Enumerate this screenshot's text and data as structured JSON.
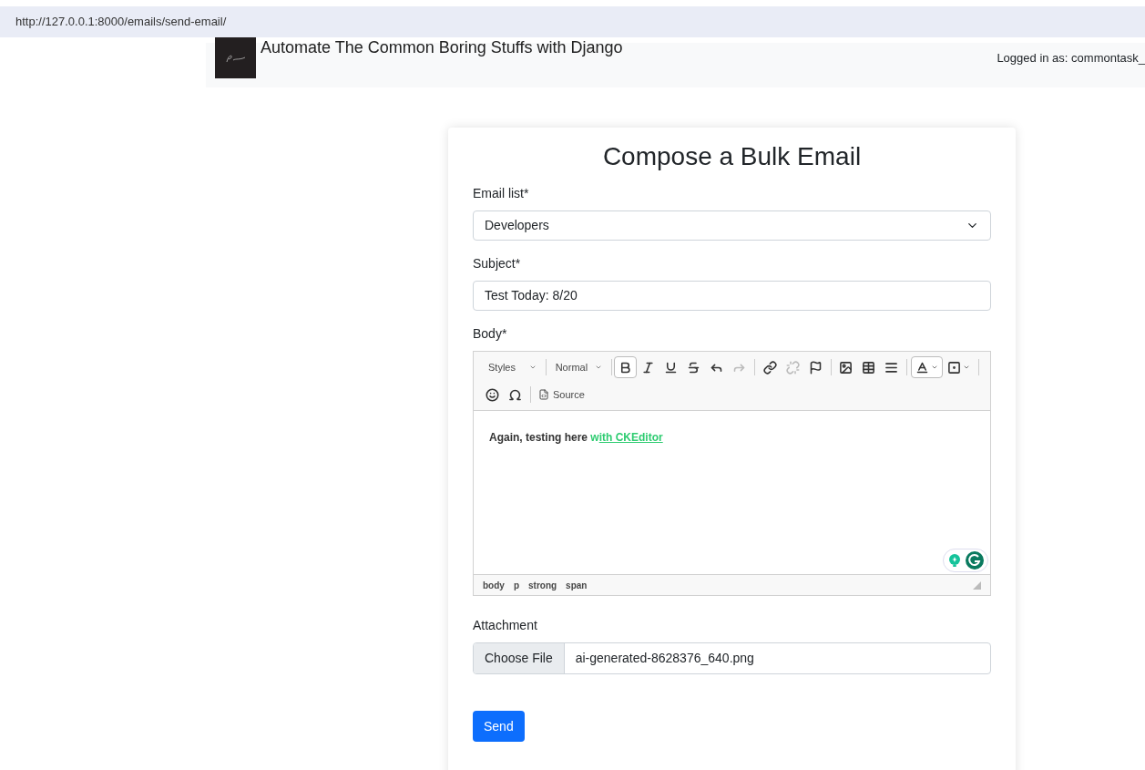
{
  "browser": {
    "url": "http://127.0.0.1:8000/emails/send-email/"
  },
  "header": {
    "title": "Automate The Common Boring Stuffs with Django",
    "user": "Logged in as: commontask_"
  },
  "form": {
    "title": "Compose a Bulk Email",
    "email_list": {
      "label": "Email list*",
      "value": "Developers"
    },
    "subject": {
      "label": "Subject*",
      "value": "Test Today: 8/20"
    },
    "body": {
      "label": "Body*",
      "combos": [
        "Styles",
        "Normal"
      ],
      "buttons": [
        {
          "active": true,
          "disabled": false
        },
        {
          "active": false,
          "disabled": false
        },
        {
          "active": false,
          "disabled": false
        },
        {
          "active": false,
          "disabled": false
        },
        {
          "active": false,
          "disabled": false
        },
        {
          "active": false,
          "disabled": true
        },
        {
          "active": false,
          "disabled": false
        },
        {
          "active": false,
          "disabled": true
        },
        {
          "active": false,
          "disabled": false
        },
        {
          "active": false,
          "disabled": false
        },
        {
          "active": false,
          "disabled": false
        },
        {
          "active": false,
          "disabled": false
        },
        {
          "active": true,
          "disabled": false
        },
        {
          "active": false,
          "disabled": false
        },
        {
          "active": false,
          "disabled": false
        },
        {
          "active": false,
          "disabled": false
        }
      ],
      "source_label": "Source",
      "content": [
        {
          "text": "Again, testing here ",
          "color": "#333333",
          "underline": false
        },
        {
          "text": "w",
          "color": "#2ecc71",
          "underline": false
        },
        {
          "text": "ith CKEditor",
          "color": "#2ecc71",
          "underline": true
        }
      ],
      "path": [
        "body",
        "p",
        "strong",
        "span"
      ]
    },
    "attachment": {
      "label": "Attachment",
      "button": "Choose File",
      "file": "ai-generated-8628376_640.png"
    },
    "submit": "Send"
  }
}
